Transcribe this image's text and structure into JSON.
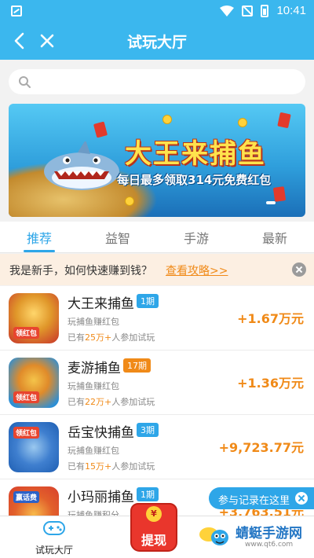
{
  "status_bar": {
    "time": "10:41"
  },
  "header": {
    "title": "试玩大厅"
  },
  "search": {
    "placeholder": ""
  },
  "banner": {
    "headline": "大王来捕鱼",
    "subline": "每日最多领取314元免费红包"
  },
  "tabs": [
    {
      "label": "推荐",
      "active": true
    },
    {
      "label": "益智",
      "active": false
    },
    {
      "label": "手游",
      "active": false
    },
    {
      "label": "最新",
      "active": false
    }
  ],
  "notice": {
    "text": "我是新手，如何快速赚到钱？",
    "link": "查看攻略>>"
  },
  "games": [
    {
      "name": "大王来捕鱼",
      "period": "1期",
      "period_color": "#2ea6e8",
      "desc": "玩捕鱼赚红包",
      "count_prefix": "已有",
      "count": "25万+",
      "count_suffix": "人参加试玩",
      "reward": "+1.67万元",
      "thumb_tag": "领红包",
      "thumb_color": "#c8342a"
    },
    {
      "name": "麦游捕鱼",
      "period": "17期",
      "period_color": "#f08a18",
      "desc": "玩捕鱼赚红包",
      "count_prefix": "已有",
      "count": "22万+",
      "count_suffix": "人参加试玩",
      "reward": "+1.36万元",
      "thumb_tag": "领红包",
      "thumb_color": "#2c8fd6"
    },
    {
      "name": "岳宝快捕鱼",
      "period": "3期",
      "period_color": "#2ea6e8",
      "desc": "玩捕鱼赚红包",
      "count_prefix": "已有",
      "count": "15万+",
      "count_suffix": "人参加试玩",
      "reward": "+9,723.77元",
      "thumb_tag": "领红包",
      "thumb_color": "#1f5fb3"
    },
    {
      "name": "小玛丽捕鱼",
      "period": "1期",
      "period_color": "#2ea6e8",
      "desc": "玩捕鱼赚积分",
      "count_prefix": "",
      "count": "",
      "count_suffix": "",
      "reward": "+3,763.51元",
      "thumb_tag": "赢话费",
      "thumb_color": "#d8402c"
    }
  ],
  "bottom_nav": {
    "label": "试玩大厅"
  },
  "withdraw": {
    "label": "提现",
    "coin": "¥"
  },
  "record_tip": {
    "label": "参与记录在这里"
  },
  "watermark": {
    "name": "蜻蜓手游网",
    "url": "www.qt6.com"
  }
}
